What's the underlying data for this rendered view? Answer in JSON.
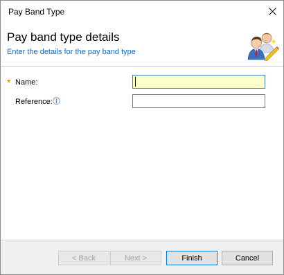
{
  "window": {
    "title": "Pay Band Type"
  },
  "header": {
    "title": "Pay band type details",
    "subtitle": "Enter the details for the pay band type"
  },
  "form": {
    "name_label": "Name:",
    "name_value": "",
    "reference_label": "Reference:",
    "reference_value": "",
    "required_marker": "*"
  },
  "buttons": {
    "back": "< Back",
    "next": "Next >",
    "finish": "Finish",
    "cancel": "Cancel"
  },
  "colors": {
    "required_star": "#e07a00",
    "subtitle": "#1a66b3",
    "active_input_bg": "#ffffcc",
    "focus_border": "#0078d7"
  }
}
